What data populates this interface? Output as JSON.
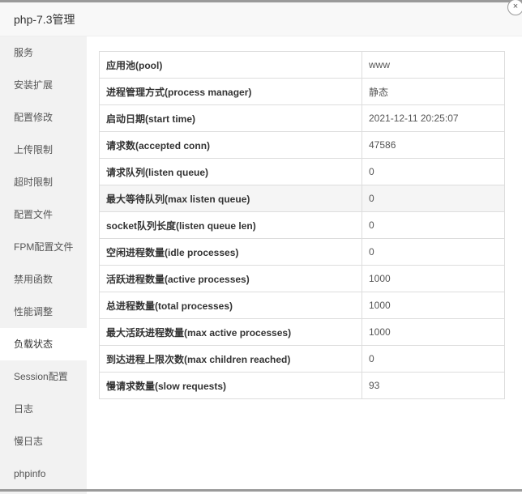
{
  "window": {
    "title": "php-7.3管理",
    "close_symbol": "×"
  },
  "sidebar": {
    "items": [
      {
        "label": "服务"
      },
      {
        "label": "安装扩展"
      },
      {
        "label": "配置修改"
      },
      {
        "label": "上传限制"
      },
      {
        "label": "超时限制"
      },
      {
        "label": "配置文件"
      },
      {
        "label": "FPM配置文件"
      },
      {
        "label": "禁用函数"
      },
      {
        "label": "性能调整"
      },
      {
        "label": "负载状态"
      },
      {
        "label": "Session配置"
      },
      {
        "label": "日志"
      },
      {
        "label": "慢日志"
      },
      {
        "label": "phpinfo"
      }
    ],
    "active_index": 9
  },
  "status_table": {
    "rows": [
      {
        "key": "应用池(pool)",
        "value": "www"
      },
      {
        "key": "进程管理方式(process manager)",
        "value": "静态"
      },
      {
        "key": "启动日期(start time)",
        "value": "2021-12-11 20:25:07"
      },
      {
        "key": "请求数(accepted conn)",
        "value": "47586"
      },
      {
        "key": "请求队列(listen queue)",
        "value": "0"
      },
      {
        "key": "最大等待队列(max listen queue)",
        "value": "0"
      },
      {
        "key": "socket队列长度(listen queue len)",
        "value": "0"
      },
      {
        "key": "空闲进程数量(idle processes)",
        "value": "0"
      },
      {
        "key": "活跃进程数量(active processes)",
        "value": "1000"
      },
      {
        "key": "总进程数量(total processes)",
        "value": "1000"
      },
      {
        "key": "最大活跃进程数量(max active processes)",
        "value": "1000"
      },
      {
        "key": "到达进程上限次数(max children reached)",
        "value": "0"
      },
      {
        "key": "慢请求数量(slow requests)",
        "value": "93"
      }
    ],
    "highlighted_row": 5
  }
}
